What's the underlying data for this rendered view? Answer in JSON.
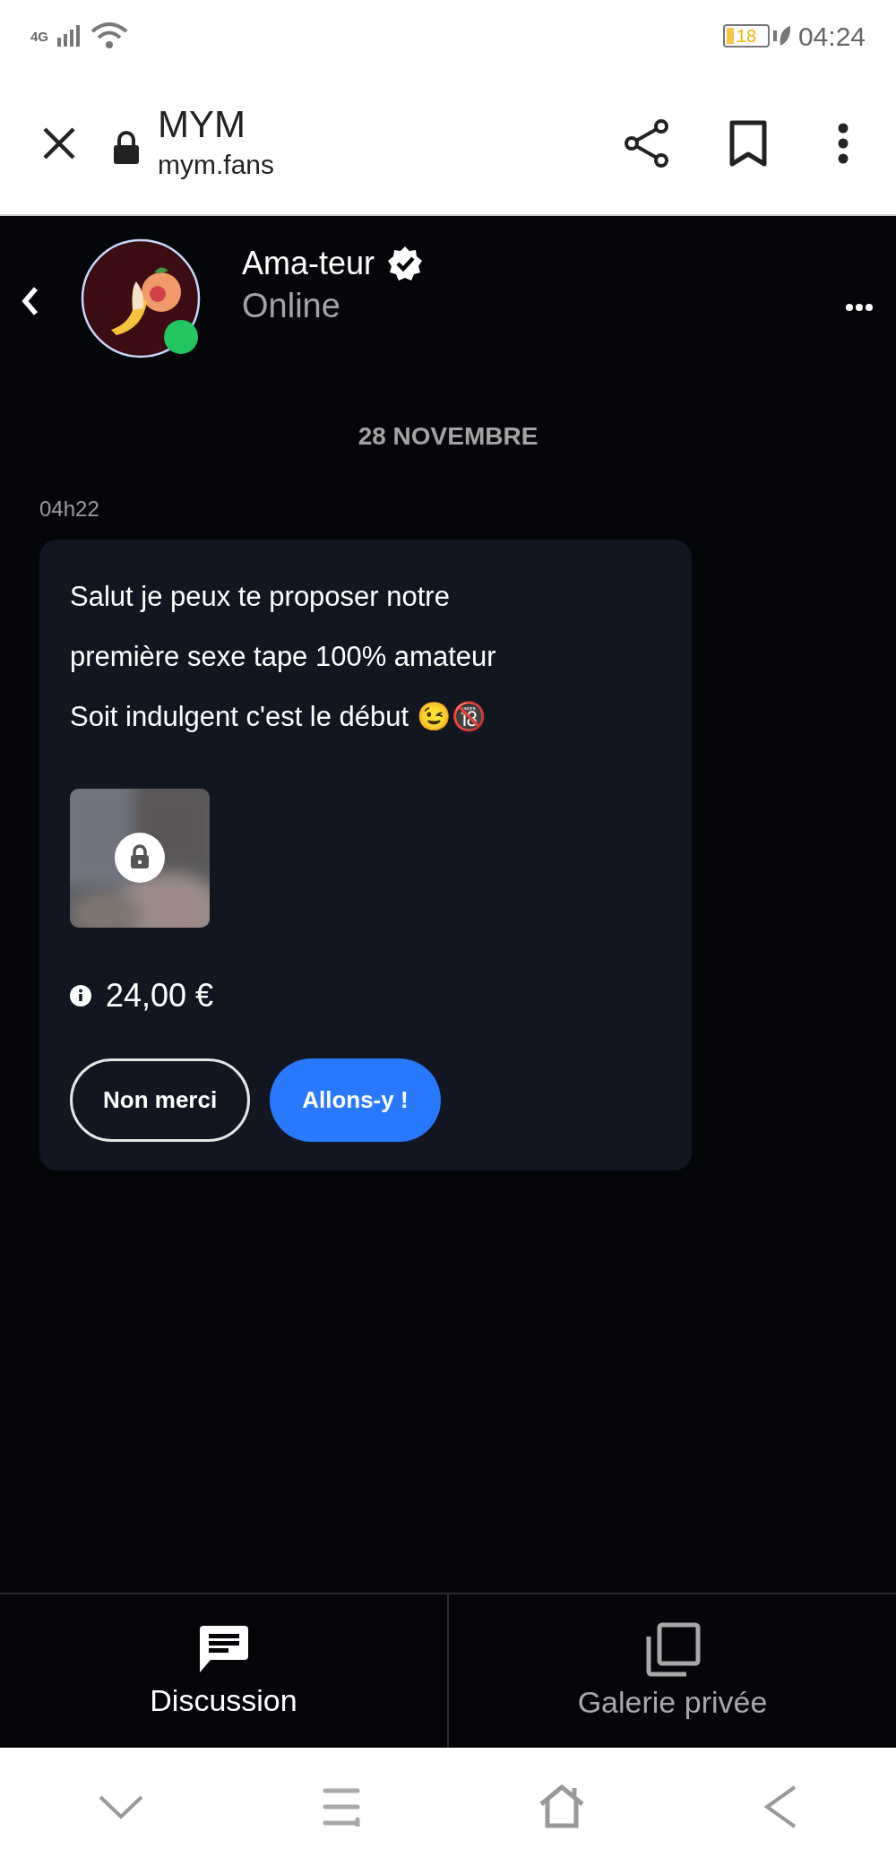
{
  "status_bar": {
    "network": "4G",
    "battery": "18",
    "time": "04:24"
  },
  "browser": {
    "title": "MYM",
    "url": "mym.fans"
  },
  "chat_header": {
    "name": "Ama-teur",
    "verified": true,
    "presence": "Online",
    "online": true
  },
  "date_divider": "28 NOVEMBRE",
  "message": {
    "time": "04h22",
    "lines": [
      "Salut je peux te proposer notre",
      "première sexe tape 100% amateur",
      "Soit indulgent c'est le début 😉🔞"
    ],
    "media": {
      "kind": "picture",
      "locked": true
    },
    "price": "24,00 €",
    "buttons": [
      {
        "label": "Non merci",
        "kind": "outline"
      },
      {
        "label": "Allons-y !",
        "kind": "primary"
      }
    ]
  },
  "tabs": [
    {
      "label": "Discussion",
      "selected": true,
      "kind": "chat"
    },
    {
      "label": "Galerie privée",
      "selected": false,
      "kind": "gallery"
    }
  ]
}
